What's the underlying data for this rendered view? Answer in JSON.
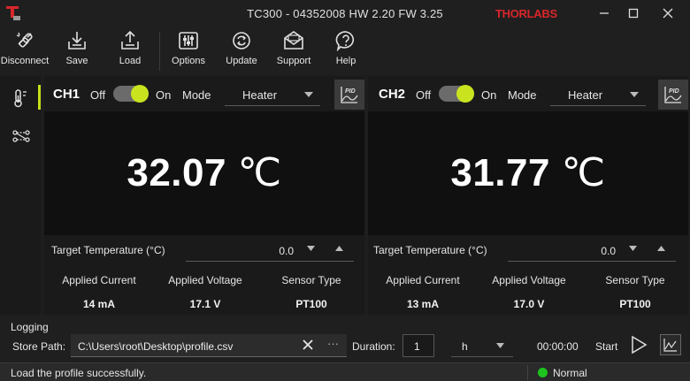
{
  "window": {
    "title": "TC300 - 04352008 HW 2.20 FW 3.25",
    "brand": "THORLABS"
  },
  "toolbar": {
    "disconnect": "Disconnect",
    "save": "Save",
    "load": "Load",
    "options": "Options",
    "update": "Update",
    "support": "Support",
    "help": "Help"
  },
  "channels": [
    {
      "name": "CH1",
      "off_label": "Off",
      "on_label": "On",
      "enabled": true,
      "mode_label": "Mode",
      "mode": "Heater",
      "temperature": "32.07",
      "unit": "℃",
      "target_label": "Target Temperature (°C)",
      "target_value": "0.0",
      "current_label": "Applied Current",
      "current_value": "14 mA",
      "voltage_label": "Applied Voltage",
      "voltage_value": "17.1 V",
      "sensor_label": "Sensor Type",
      "sensor_value": "PT100"
    },
    {
      "name": "CH2",
      "off_label": "Off",
      "on_label": "On",
      "enabled": true,
      "mode_label": "Mode",
      "mode": "Heater",
      "temperature": "31.77",
      "unit": "℃",
      "target_label": "Target Temperature (°C)",
      "target_value": "0.0",
      "current_label": "Applied Current",
      "current_value": "13 mA",
      "voltage_label": "Applied Voltage",
      "voltage_value": "17.0 V",
      "sensor_label": "Sensor Type",
      "sensor_value": "PT100"
    }
  ],
  "logging": {
    "title": "Logging",
    "store_path_label": "Store Path:",
    "store_path": "C:\\Users\\root\\Desktop\\profile.csv",
    "more": "···",
    "duration_label": "Duration:",
    "duration_value": "1",
    "duration_unit": "h",
    "elapsed": "00:00:00",
    "start_label": "Start"
  },
  "status": {
    "message": "Load the profile successfully.",
    "state": "Normal",
    "state_color": "#1ec31e"
  },
  "colors": {
    "accent": "#c9e41f",
    "brand": "#d9262b"
  }
}
